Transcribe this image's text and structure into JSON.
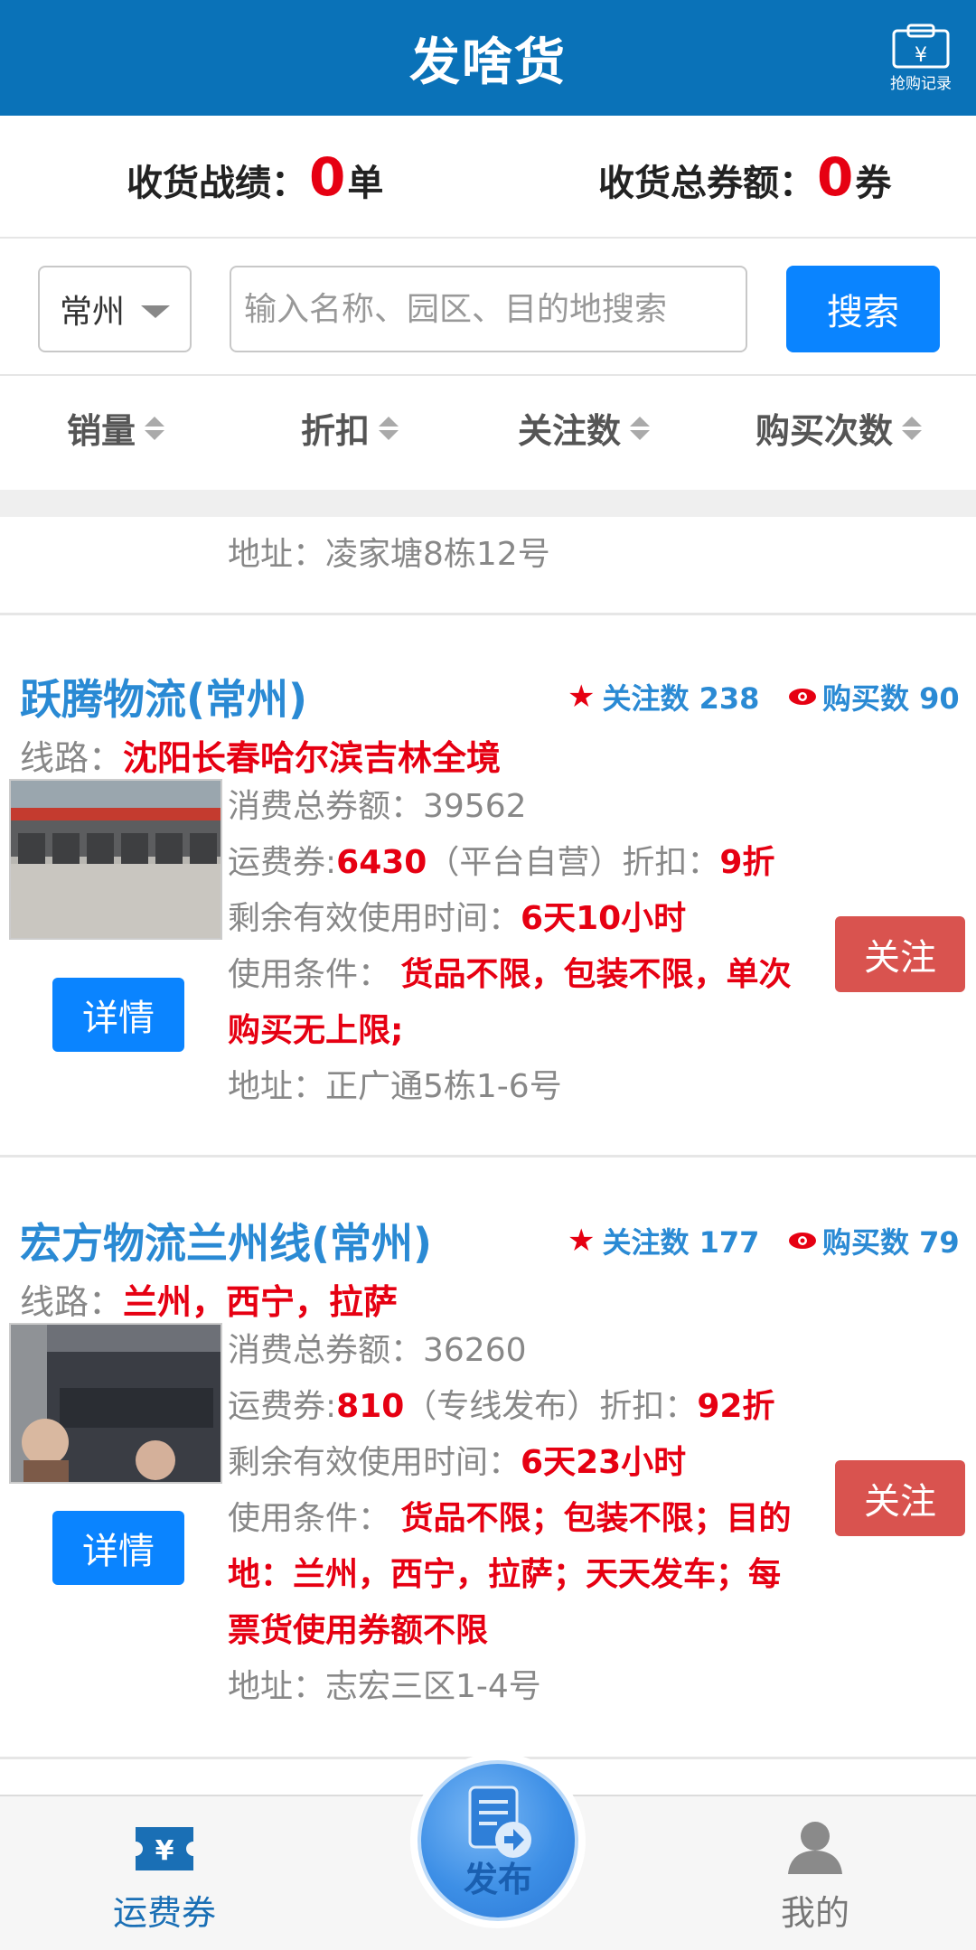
{
  "header": {
    "title": "发啥货",
    "history_label": "抢购记录"
  },
  "stats": {
    "received_label": "收货战绩：",
    "received_value": "0",
    "received_unit": "单",
    "coupon_label": "收货总券额：",
    "coupon_value": "0",
    "coupon_unit": "券"
  },
  "search": {
    "city": "常州",
    "placeholder": "输入名称、园区、目的地搜索",
    "button": "搜索"
  },
  "sort": {
    "items": [
      "销量",
      "折扣",
      "关注数",
      "购买次数"
    ]
  },
  "list": {
    "partial_address": "地址：凌家塘8栋12号",
    "cards": [
      {
        "name": "跃腾物流(常州)",
        "fav_label": "关注数 238",
        "buy_label": "购买数 90",
        "route_label": "线路：",
        "route_value": "沈阳长春哈尔滨吉林全境",
        "total_coupon": "消费总券额：39562",
        "fee_label": "运费券:",
        "fee_value": "6430",
        "fee_type": "（平台自营）折扣：",
        "discount": "9折",
        "remaining_label": "剩余有效使用时间：",
        "remaining_value": "6天10小时",
        "condition_label": "使用条件：",
        "condition_value": "货品不限，包装不限，单次购买无上限;",
        "address": "地址：正广通5栋1-6号",
        "detail_button": "详情",
        "follow_button": "关注"
      },
      {
        "name": "宏方物流兰州线(常州)",
        "fav_label": "关注数 177",
        "buy_label": "购买数 79",
        "route_label": "线路：",
        "route_value": "兰州，西宁，拉萨",
        "total_coupon": "消费总券额：36260",
        "fee_label": "运费券:",
        "fee_value": "810",
        "fee_type": "（专线发布）折扣：",
        "discount": "92折",
        "remaining_label": "剩余有效使用时间：",
        "remaining_value": "6天23小时",
        "condition_label": "使用条件：",
        "condition_value": "货品不限；包装不限；目的地：兰州，西宁，拉萨；天天发车；每票货使用券额不限",
        "address": "地址：志宏三区1-4号",
        "detail_button": "详情",
        "follow_button": "关注"
      }
    ]
  },
  "bottom_nav": {
    "left_label": "运费券",
    "center_label": "发布",
    "right_label": "我的"
  },
  "colors": {
    "primary": "#0a72b8",
    "button_blue": "#0a84ff",
    "accent_red": "#e60012",
    "follow_red": "#d9534f",
    "link_blue": "#2a8ad4"
  },
  "icons": {
    "history": "cart-coupon-icon",
    "coupon": "yen-ticket-icon",
    "publish": "document-send-icon",
    "profile": "user-icon",
    "star": "star-icon",
    "eye": "eye-icon"
  }
}
